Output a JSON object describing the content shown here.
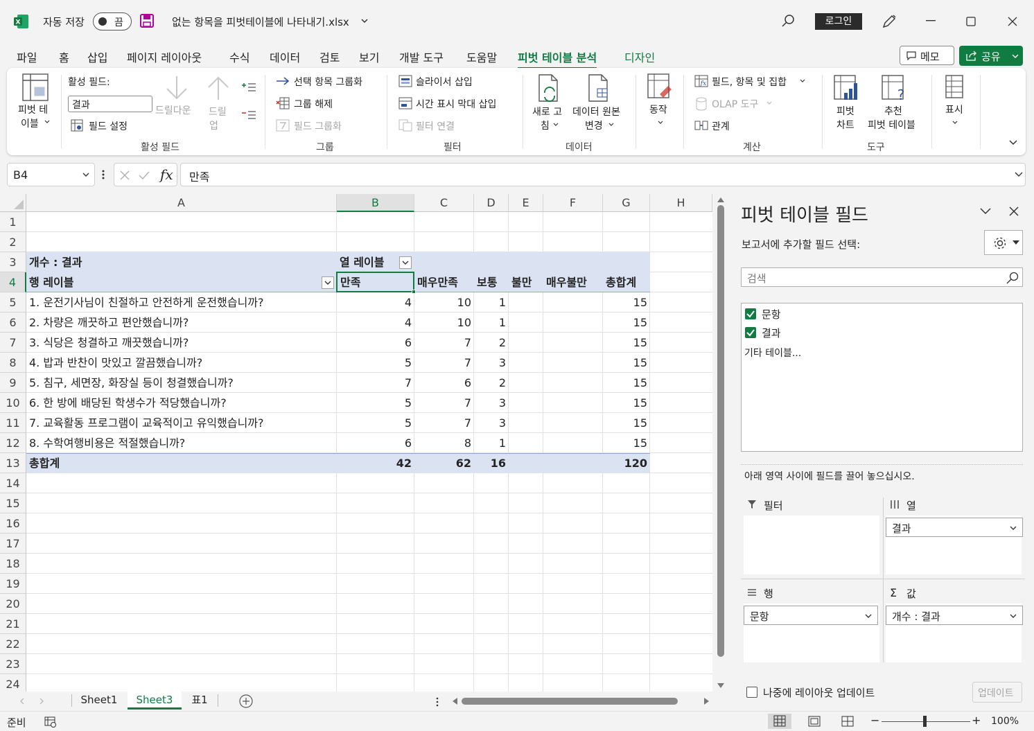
{
  "titlebar": {
    "autosave_label": "자동 저장",
    "autosave_state": "끔",
    "filename": "없는 항목을 피벗테이블에 나타내기.xlsx",
    "login": "로그인"
  },
  "menu": {
    "tabs": [
      "파일",
      "홈",
      "삽입",
      "페이지 레이아웃",
      "수식",
      "데이터",
      "검토",
      "보기",
      "개발 도구",
      "도움말",
      "피벗 테이블 분석",
      "디자인"
    ],
    "memo": "메모",
    "share": "공유"
  },
  "ribbon": {
    "pivot_table": [
      "피벗 테",
      "이블"
    ],
    "active_field_label": "활성 필드:",
    "active_field_value": "결과",
    "field_settings": "필드 설정",
    "drill_down": "드릴다운",
    "drill_up": [
      "드릴",
      "업"
    ],
    "active_field_group": "활성 필드",
    "group_selection": "선택 항목 그룹화",
    "ungroup": "그룹 해제",
    "group_field": "필드 그룹화",
    "group_group": "그룹",
    "insert_slicer": "슬라이서 삽입",
    "insert_timeline": "시간 표시 막대 삽입",
    "filter_connections": "필터 연결",
    "filter_group": "필터",
    "refresh": [
      "새로 고",
      "침"
    ],
    "change_source": [
      "데이터 원본",
      "변경"
    ],
    "data_group": "데이터",
    "actions": "동작",
    "fields_items_sets": "필드, 항목 및 집합",
    "olap_tools": "OLAP 도구",
    "relationships": "관계",
    "calc_group": "계산",
    "pivot_chart": [
      "피벗",
      "차트"
    ],
    "recommended": [
      "추천",
      "피벗 테이블"
    ],
    "tools_group": "도구",
    "show": "표시"
  },
  "formula_bar": {
    "name_box": "B4",
    "content": "만족"
  },
  "sheet": {
    "columns": [
      "A",
      "B",
      "C",
      "D",
      "E",
      "F",
      "G",
      "H"
    ],
    "rows": [
      "1",
      "2",
      "3",
      "4",
      "5",
      "6",
      "7",
      "8",
      "9",
      "10",
      "11",
      "12",
      "13",
      "14",
      "15",
      "16",
      "17",
      "18",
      "19",
      "20",
      "21",
      "22",
      "23",
      "24"
    ],
    "pivot": {
      "count_label": "개수 : 결과",
      "col_labels": "열 레이블",
      "row_labels": "행 레이블",
      "headers": [
        "만족",
        "매우만족",
        "보통",
        "불만",
        "매우불만",
        "총합계"
      ],
      "data": [
        {
          "q": "1. 운전기사님이 친절하고 안전하게 운전했습니까?",
          "v": [
            "4",
            "10",
            "1",
            "",
            "",
            "15"
          ]
        },
        {
          "q": "2. 차량은 깨끗하고 편안했습니까?",
          "v": [
            "4",
            "10",
            "1",
            "",
            "",
            "15"
          ]
        },
        {
          "q": "3. 식당은 청결하고 깨끗했습니까?",
          "v": [
            "6",
            "7",
            "2",
            "",
            "",
            "15"
          ]
        },
        {
          "q": "4. 밥과 반찬이 맛있고 깔끔했습니까?",
          "v": [
            "5",
            "7",
            "3",
            "",
            "",
            "15"
          ]
        },
        {
          "q": "5. 침구, 세면장, 화장실 등이 청결했습니까?",
          "v": [
            "7",
            "6",
            "2",
            "",
            "",
            "15"
          ]
        },
        {
          "q": "6. 한 방에 배당된 학생수가 적당했습니까?",
          "v": [
            "5",
            "7",
            "3",
            "",
            "",
            "15"
          ]
        },
        {
          "q": "7. 교육활동 프로그램이 교육적이고 유익했습니까?",
          "v": [
            "5",
            "7",
            "3",
            "",
            "",
            "15"
          ]
        },
        {
          "q": "8. 수학여행비용은 적절했습니까?",
          "v": [
            "6",
            "8",
            "1",
            "",
            "",
            "15"
          ]
        }
      ],
      "total_label": "총합계",
      "totals": [
        "42",
        "62",
        "16",
        "",
        "",
        "120"
      ]
    }
  },
  "sheet_tabs": [
    "Sheet1",
    "Sheet3",
    "표1"
  ],
  "status": {
    "ready": "준비",
    "zoom": "100%"
  },
  "pane": {
    "title": "피벗 테이블 필드",
    "choose_fields": "보고서에 추가할 필드 선택:",
    "search_placeholder": "검색",
    "fields": [
      "문항",
      "결과"
    ],
    "more_tables": "기타 테이블...",
    "drag_hint": "아래 영역 사이에 필드를 끌어 놓으십시오.",
    "filter_area": "필터",
    "column_area": "열",
    "column_value": "결과",
    "row_area": "행",
    "row_value": "문항",
    "values_area": "값",
    "values_value": "개수 : 결과",
    "defer_update": "나중에 레이아웃 업데이트",
    "update": "업데이트"
  },
  "colors": {
    "accent": "#107c41",
    "pivot_header": "#dbe3f3"
  }
}
